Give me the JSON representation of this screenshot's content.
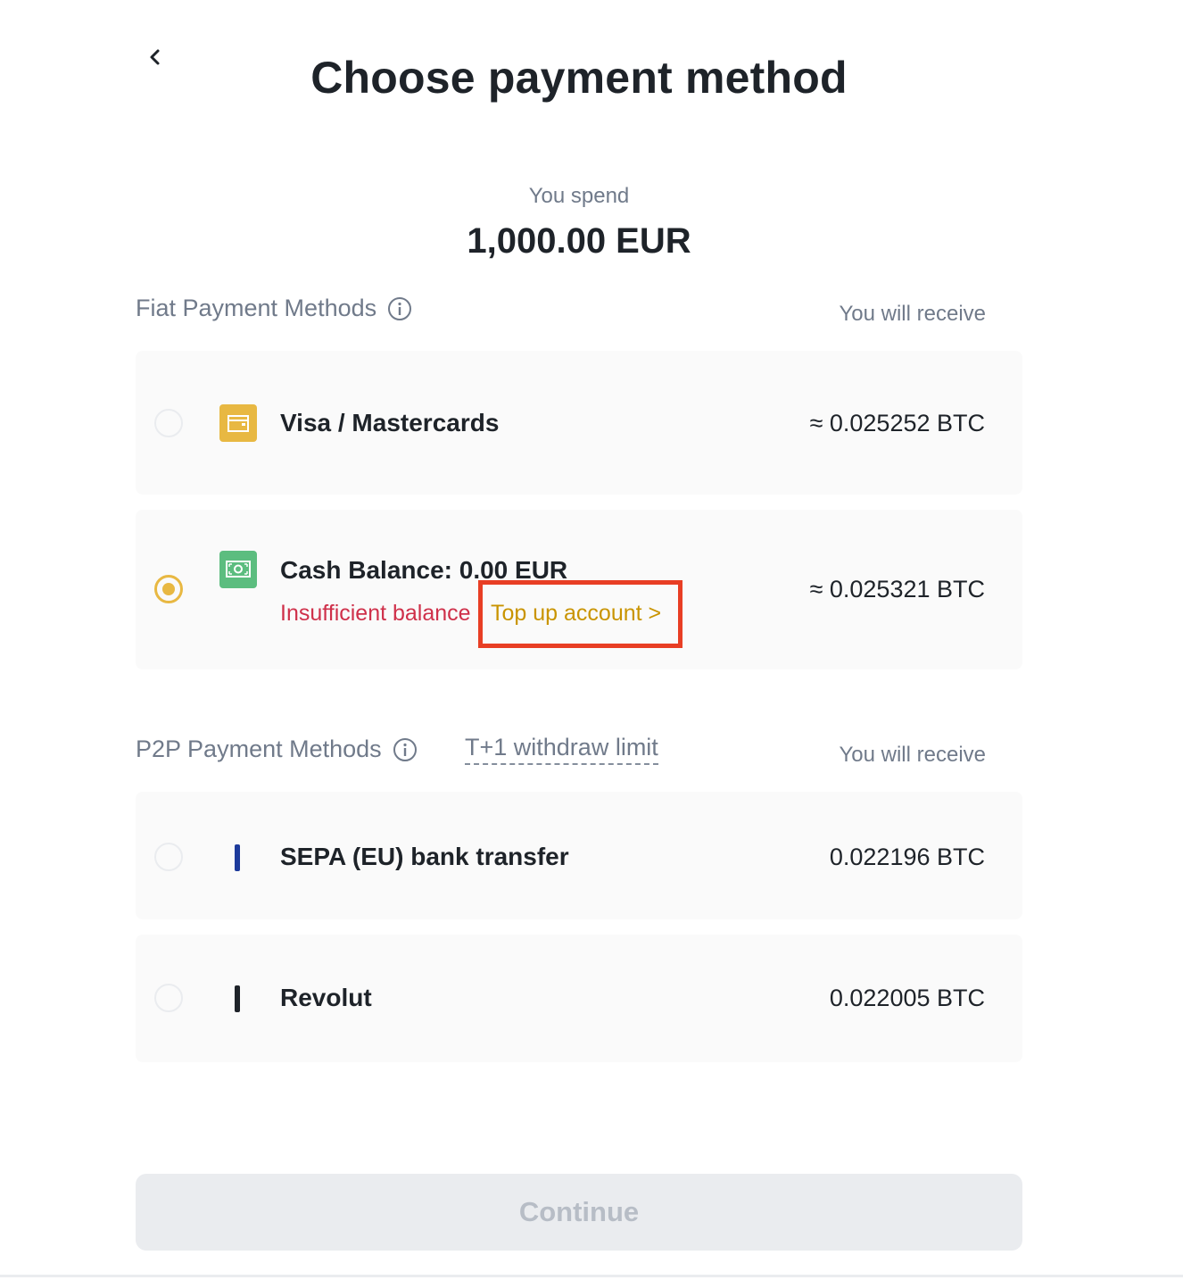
{
  "header": {
    "back_icon": "chevron-left-icon",
    "title": "Choose payment method"
  },
  "spend": {
    "label": "You spend",
    "amount": "1,000.00 EUR"
  },
  "fiat_section": {
    "title": "Fiat Payment Methods",
    "info_icon": "info-circle-icon",
    "receive_label": "You will receive",
    "methods": [
      {
        "name": "Visa / Mastercards",
        "icon": "card-icon",
        "value": "≈ 0.025252 BTC",
        "selected": false
      },
      {
        "name": "Cash Balance: 0.00 EUR",
        "icon": "cash-icon",
        "value": "≈ 0.025321 BTC",
        "selected": true,
        "warning": "Insufficient balance",
        "action_link": "Top up account >"
      }
    ]
  },
  "p2p_section": {
    "title": "P2P Payment Methods",
    "info_icon": "info-circle-icon",
    "withdraw_limit": "T+1 withdraw limit",
    "receive_label": "You will receive",
    "methods": [
      {
        "name": "SEPA (EU) bank transfer",
        "icon": "bar-icon",
        "icon_color": "#1c3a9b",
        "value": "0.022196 BTC",
        "selected": false
      },
      {
        "name": "Revolut",
        "icon": "bar-icon",
        "icon_color": "#1e2329",
        "value": "0.022005 BTC",
        "selected": false
      }
    ]
  },
  "footer": {
    "continue_label": "Continue"
  },
  "colors": {
    "accent": "#e8b842",
    "error": "#cf304a",
    "link": "#c99400",
    "highlight_box": "#e83e24"
  }
}
